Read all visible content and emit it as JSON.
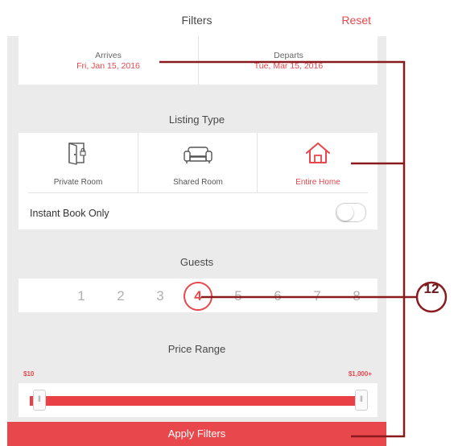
{
  "header": {
    "title": "Filters",
    "reset_label": "Reset"
  },
  "dates": {
    "arrives_label": "Arrives",
    "arrives_value": "Fri, Jan 15, 2016",
    "departs_label": "Departs",
    "departs_value": "Tue, Mar 15, 2016"
  },
  "listing_type": {
    "title": "Listing Type",
    "options": [
      {
        "label": "Private Room",
        "icon": "door-icon"
      },
      {
        "label": "Shared Room",
        "icon": "sofa-icon"
      },
      {
        "label": "Entire Home",
        "icon": "house-icon",
        "selected": true
      }
    ],
    "instant_book_label": "Instant Book Only",
    "instant_book_on": false
  },
  "guests": {
    "title": "Guests",
    "numbers": [
      "1",
      "2",
      "3",
      "4",
      "5",
      "6",
      "7",
      "8"
    ],
    "selected": "4"
  },
  "price": {
    "title": "Price Range",
    "min_label": "$10",
    "max_label": "$1,000+",
    "range": [
      0,
      1
    ]
  },
  "apply_label": "Apply Filters",
  "callout": {
    "number": "12"
  },
  "colors": {
    "accent": "#e8474c",
    "callout": "#8b1a1f",
    "background": "#ebebeb"
  }
}
